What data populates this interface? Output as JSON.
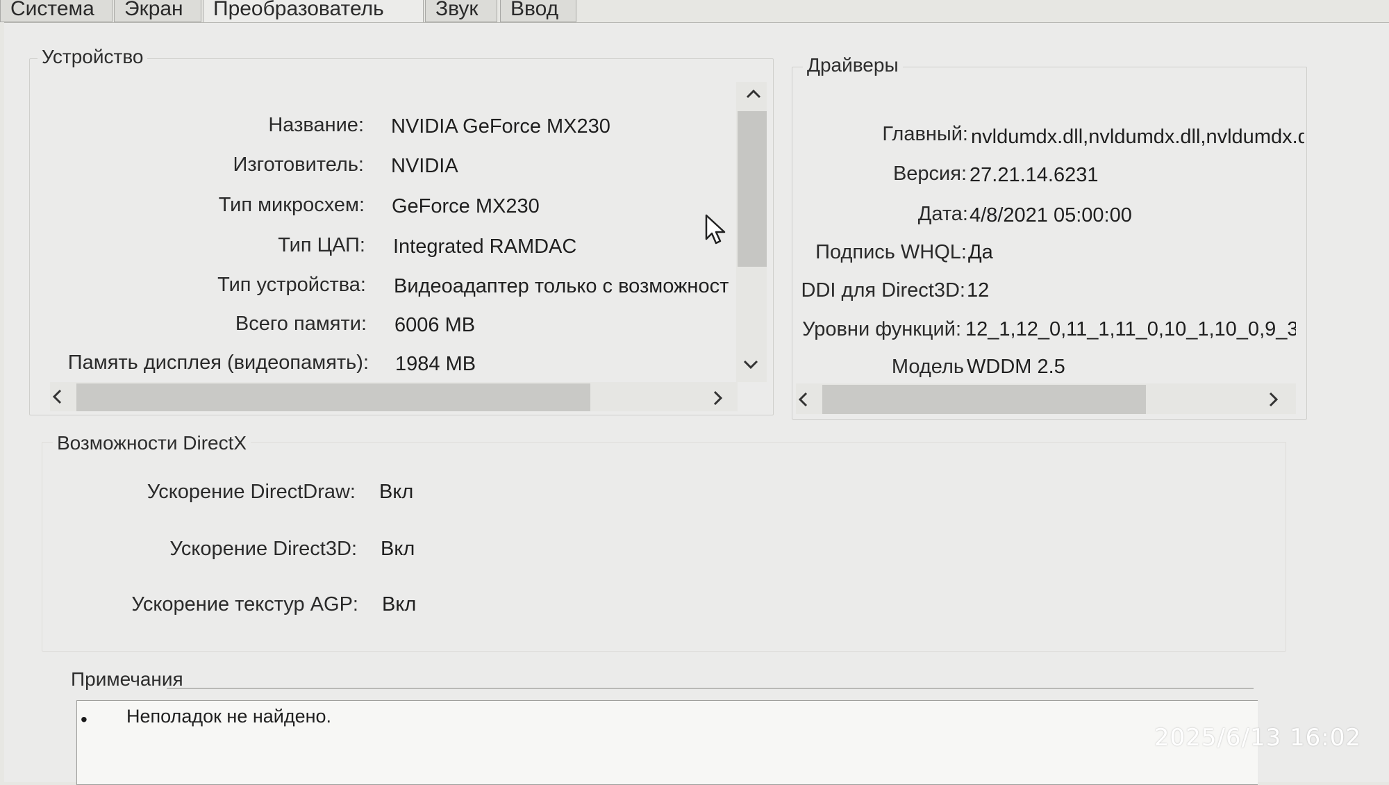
{
  "tabs": [
    {
      "label": "Система"
    },
    {
      "label": "Экран"
    },
    {
      "label": "Преобразователь"
    },
    {
      "label": "Звук"
    },
    {
      "label": "Ввод"
    }
  ],
  "device": {
    "title": "Устройство",
    "rows": [
      {
        "label": "Название:",
        "value": "NVIDIA GeForce MX230"
      },
      {
        "label": "Изготовитель:",
        "value": "NVIDIA"
      },
      {
        "label": "Тип микросхем:",
        "value": "GeForce MX230"
      },
      {
        "label": "Тип ЦАП:",
        "value": "Integrated RAMDAC"
      },
      {
        "label": "Тип устройства:",
        "value": "Видеоадаптер только с возможност"
      },
      {
        "label": "Всего памяти:",
        "value": "6006 MB"
      },
      {
        "label": "Память дисплея (видеопамять):",
        "value": "1984 MB"
      }
    ]
  },
  "drivers": {
    "title": "Драйверы",
    "rows": [
      {
        "label": "Главный:",
        "value": "nvldumdx.dll,nvldumdx.dll,nvldumdx.d"
      },
      {
        "label": "Версия:",
        "value": "27.21.14.6231"
      },
      {
        "label": "Дата:",
        "value": "4/8/2021 05:00:00"
      },
      {
        "label": "Подпись WHQL:",
        "value": "Да"
      },
      {
        "label": "DDI для Direct3D:",
        "value": "12"
      },
      {
        "label": "Уровни функций:",
        "value": "12_1,12_0,11_1,11_0,10_1,10_0,9_3"
      },
      {
        "label": "Модель",
        "value": "WDDM 2.5"
      }
    ]
  },
  "directx": {
    "title": "Возможности DirectX",
    "rows": [
      {
        "label": "Ускорение DirectDraw:",
        "value": "Вкл"
      },
      {
        "label": "Ускорение Direct3D:",
        "value": "Вкл"
      },
      {
        "label": "Ускорение текстур AGP:",
        "value": "Вкл"
      }
    ]
  },
  "notes": {
    "title": "Примечания",
    "items": [
      "Неполадок не найдено."
    ]
  },
  "icons": {
    "scroll_up": "chevron-up-icon",
    "scroll_down": "chevron-down-icon",
    "scroll_left": "chevron-left-icon",
    "scroll_right": "chevron-right-icon",
    "cursor": "mouse-pointer-icon"
  },
  "overlay": {
    "timestamp": "2025/6/13  16:02"
  }
}
